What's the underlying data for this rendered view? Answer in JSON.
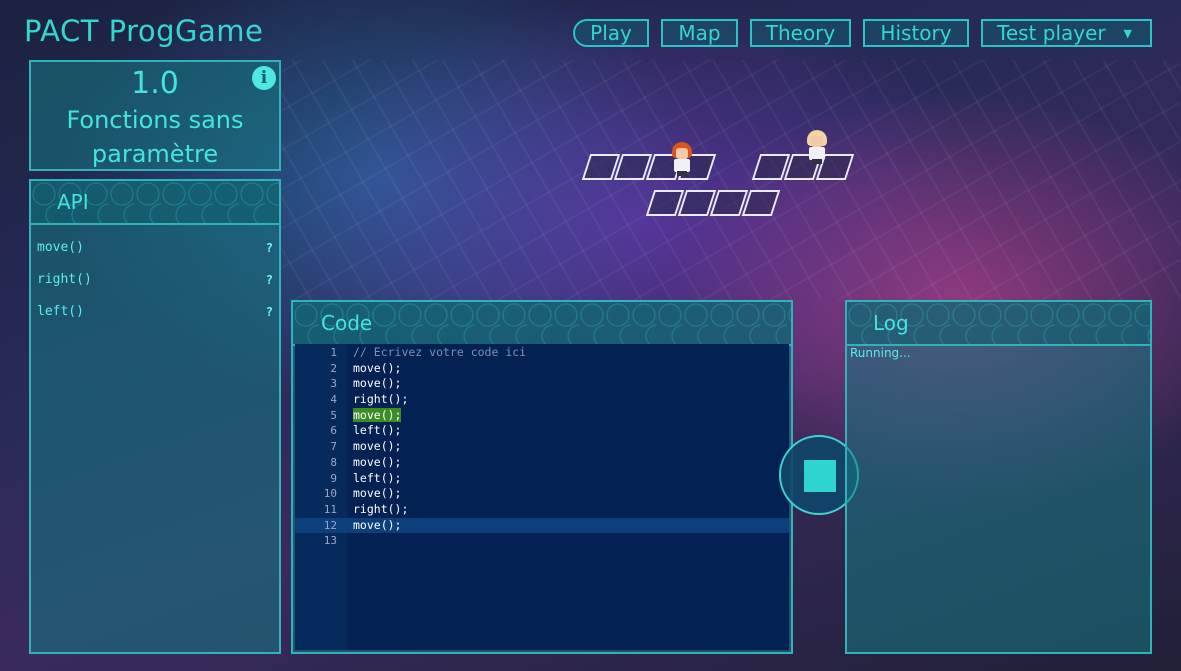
{
  "app": {
    "title": "PACT ProgGame"
  },
  "nav": {
    "play": "Play",
    "map": "Map",
    "theory": "Theory",
    "history": "History",
    "player": "Test player"
  },
  "level": {
    "number": "1.0",
    "name_line1": "Fonctions sans",
    "name_line2": "paramètre",
    "info_icon": "info-icon"
  },
  "api": {
    "title": "API",
    "items": [
      {
        "name": "move()",
        "help": "?"
      },
      {
        "name": "right()",
        "help": "?"
      },
      {
        "name": "left()",
        "help": "?"
      }
    ]
  },
  "code": {
    "title": "Code",
    "executing_line": 5,
    "cursor_line": 12,
    "lines": [
      {
        "n": "1",
        "text": "// Ecrivez votre code ici"
      },
      {
        "n": "2",
        "text": "move();"
      },
      {
        "n": "3",
        "text": "move();"
      },
      {
        "n": "4",
        "text": "right();"
      },
      {
        "n": "5",
        "text": "move();"
      },
      {
        "n": "6",
        "text": "left();"
      },
      {
        "n": "7",
        "text": "move();"
      },
      {
        "n": "8",
        "text": "move();"
      },
      {
        "n": "9",
        "text": "left();"
      },
      {
        "n": "10",
        "text": "move();"
      },
      {
        "n": "11",
        "text": "right();"
      },
      {
        "n": "12",
        "text": "move();"
      },
      {
        "n": "13",
        "text": ""
      }
    ]
  },
  "log": {
    "title": "Log",
    "text": "Running..."
  },
  "controls": {
    "stop_icon": "stop-icon"
  },
  "colors": {
    "accent": "#35d6d0",
    "panel_border": "#2fb3b8",
    "editor_bg": "#032152",
    "exec_highlight": "#3a8e22"
  }
}
